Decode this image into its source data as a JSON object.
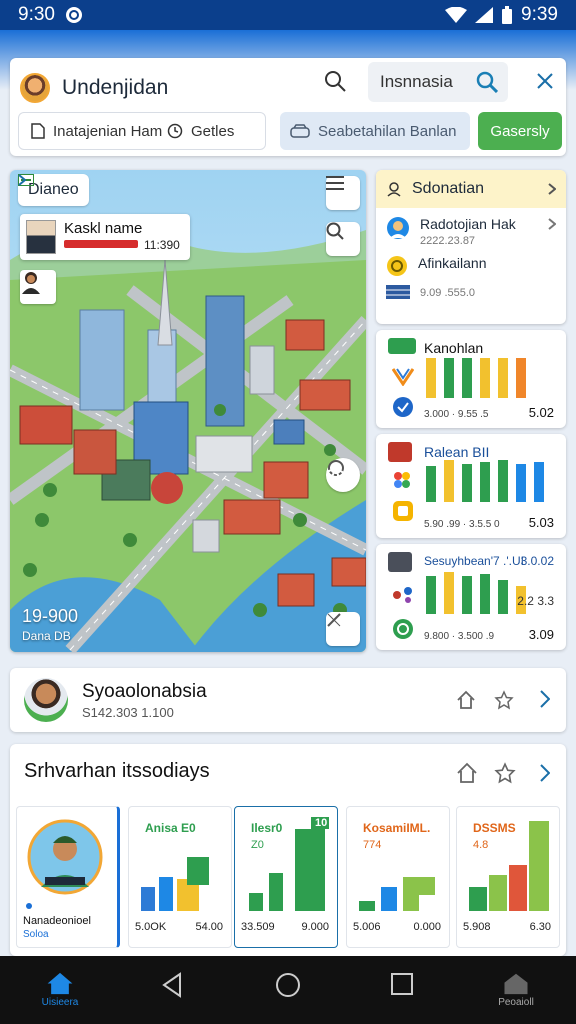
{
  "status_bar": {
    "time_left": "9:30",
    "time_right": "9:39"
  },
  "header": {
    "app_title": "Undenjidan",
    "search_value": "Insnnasia",
    "filter_left_label": "Inatajenian Ham",
    "filter_right_label": "Getles",
    "location_label": "Seabetahilan Banlan",
    "cta_label": "Gasersly"
  },
  "map": {
    "layer_label": "Dianeo",
    "person_name": "Kaskl name",
    "person_value": "11:390",
    "coord_main": "19-900",
    "coord_sub": "Dana DB"
  },
  "panels": {
    "p1": {
      "title": "Sdonatian",
      "row1_title": "Radotojian Hak",
      "row1_sub": "2222.23.87",
      "row2_title": "Afinkailann",
      "row3_sub": "9.09 .555.0"
    },
    "p2": {
      "title": "Kanohlan",
      "foot": "3.000 · 9.55 .5",
      "foot_right": "5.02"
    },
    "p3": {
      "title": "Ralean BII",
      "foot": "5.90 .99 · 3.5.5 0",
      "foot_right": "5.03"
    },
    "p4": {
      "title": "Sesuyhbean'7 .'.UI",
      "title_right": "3.0.02",
      "foot": "9.800 · 3.500 .9",
      "foot_right": "3.09",
      "side_text": "2.2 3.3"
    }
  },
  "profile": {
    "name": "Syoaolonabsia",
    "sub": "S142.303 1.100"
  },
  "section": {
    "title": "Srhvarhan itssodiays",
    "cards": [
      {
        "title": "Nanadeonioel",
        "sub": "Soloa"
      },
      {
        "title": "Anisa E0",
        "sub": "",
        "foot_left": "5.0OK",
        "foot_right": "54.00"
      },
      {
        "title": "Ilesr0",
        "sub": "Z0",
        "badge": "10",
        "foot_left": "33.509",
        "foot_right": "9.000"
      },
      {
        "title": "KosamiIML.",
        "sub": "774",
        "foot_left": "5.006",
        "foot_right": "0.000"
      },
      {
        "title": "DSSMS",
        "sub": "4.8",
        "foot_left": "5.908",
        "foot_right": "6.30"
      }
    ]
  },
  "nav": {
    "home_label": "Uisieera",
    "right_label": "Peoaioll"
  }
}
